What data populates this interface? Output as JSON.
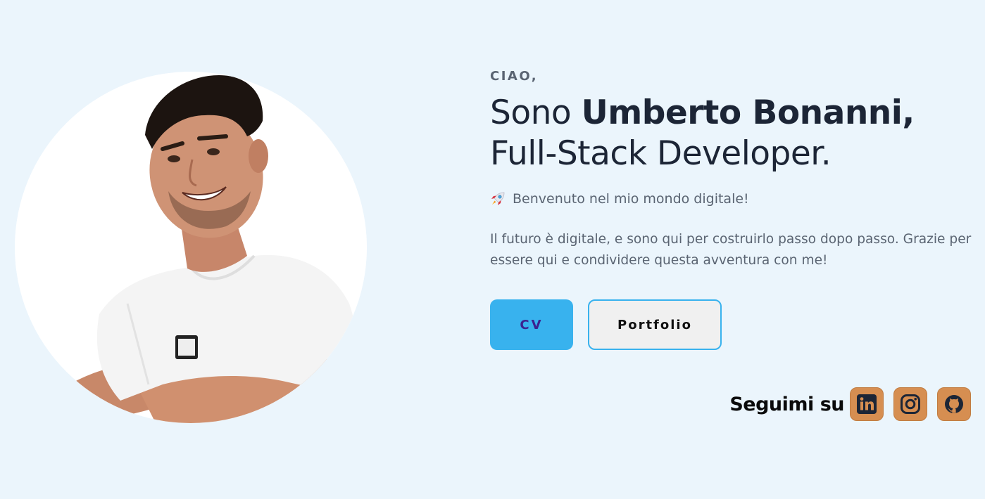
{
  "hero": {
    "greeting": "CIAO,",
    "headline_prefix": "Sono ",
    "name": "Umberto Bonanni,",
    "role": "Full-Stack Developer.",
    "welcome_icon": "rocket-icon",
    "welcome": "Benvenuto nel mio mondo digitale!",
    "intro": "Il futuro è digitale, e sono qui per costruirlo passo dopo passo. Grazie per essere qui e condividere questa avventura con me!"
  },
  "buttons": {
    "cv_label": "CV",
    "portfolio_label": "Portfolio"
  },
  "social": {
    "label": "Seguimi su",
    "links": [
      {
        "name": "LinkedIn",
        "icon": "linkedin-icon"
      },
      {
        "name": "Instagram",
        "icon": "instagram-icon"
      },
      {
        "name": "GitHub",
        "icon": "github-icon"
      }
    ]
  },
  "colors": {
    "background": "#ebf5fc",
    "primary": "#38b2ee",
    "social_button": "#d68e51",
    "text_dark": "#1c2536",
    "text_muted": "#5a6472"
  }
}
